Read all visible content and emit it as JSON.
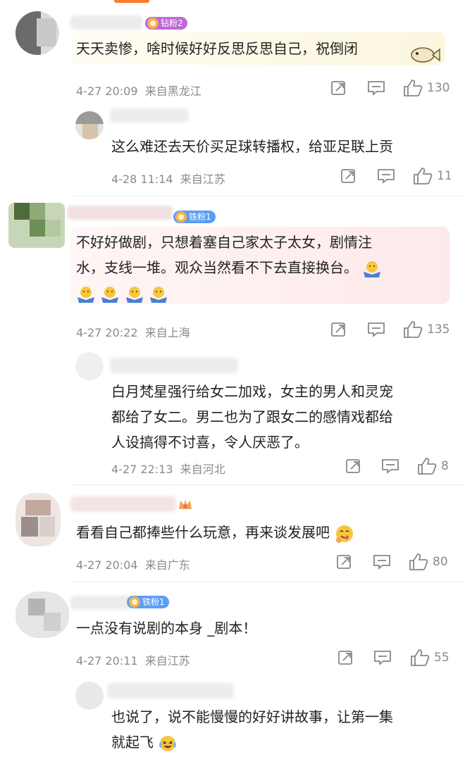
{
  "comments": [
    {
      "badge": "钻粉2",
      "badge_color": "#c067d6",
      "text_lines": [
        "天天卖惨，啥时候好好反思反思自己，祝倒闭"
      ],
      "time": "4-27 20:09",
      "location": "来自黑龙江",
      "likes": "130"
    },
    {
      "badge": "",
      "text_lines": [
        "这么难还去天价买足球转播权，给亚足联上贡"
      ],
      "time": "4-28 11:14",
      "location": "来自江苏",
      "likes": "11"
    },
    {
      "badge": "铁粉1",
      "badge_color": "#5b9ef5",
      "text_lines": [
        "不好好做剧，只想着塞自己家太子太女，剧情注",
        "水，支线一堆。观众当然看不下去直接换台。"
      ],
      "time": "4-27 20:22",
      "location": "来自上海",
      "likes": "135"
    },
    {
      "badge": "",
      "text_lines": [
        "白月梵星强行给女二加戏，女主的男人和灵宠",
        "都给了女二。男二也为了跟女二的感情戏都给",
        "人设搞得不讨喜，令人厌恶了。"
      ],
      "time": "4-27 22:13",
      "location": "来自河北",
      "likes": "8"
    },
    {
      "badge": "",
      "text_lines": [
        "看看自己都捧些什么玩意，再来谈发展吧"
      ],
      "time": "4-27 20:04",
      "location": "来自广东",
      "likes": "80"
    },
    {
      "badge": "铁粉1",
      "badge_color": "#5b9ef5",
      "text_lines": [
        "一点没有说剧的本身 _剧本！"
      ],
      "time": "4-27 20:11",
      "location": "来自江苏",
      "likes": "55"
    },
    {
      "badge": "",
      "text_lines": [
        "也说了，说不能慢慢的好好讲故事，让第一集",
        "就起飞"
      ]
    }
  ],
  "icons": {
    "share": "share-icon",
    "comment": "comment-icon",
    "like": "thumbs-up-icon"
  }
}
